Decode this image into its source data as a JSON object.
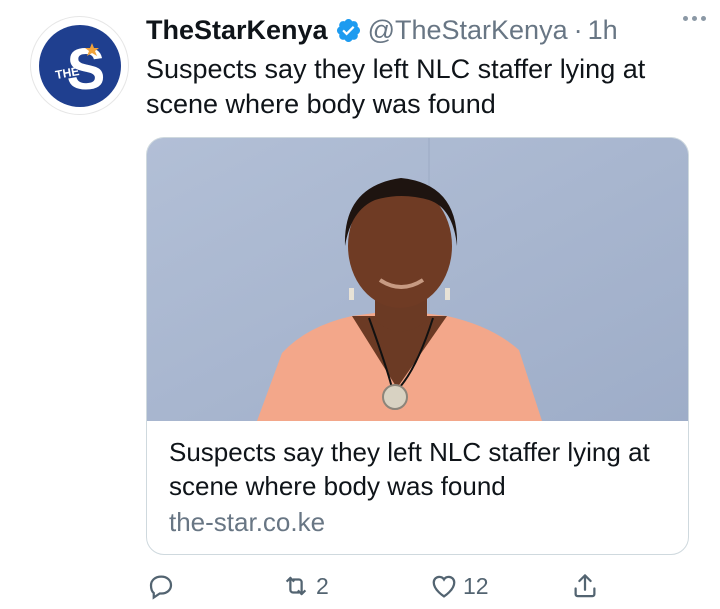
{
  "account": {
    "display_name": "TheStarKenya",
    "handle": "@TheStarKenya",
    "separator": "·",
    "time_ago": "1h",
    "avatar_letter": "S",
    "avatar_small_text": "THE"
  },
  "tweet": {
    "text": "Suspects say they left NLC staffer lying at scene where body was found"
  },
  "card": {
    "title": "Suspects say they left NLC staffer lying at scene where body was found",
    "domain": "the-star.co.ke"
  },
  "actions": {
    "reply_count": "",
    "retweet_count": "2",
    "like_count": "12"
  },
  "colors": {
    "brand_blue": "#1f3f8f",
    "verified": "#1d9bf0",
    "secondary_text": "#687684",
    "image_background": "#a9b7cf",
    "shirt": "#f3a78a"
  },
  "icons": [
    "verified-badge-icon",
    "more-options-icon",
    "reply-icon",
    "retweet-icon",
    "like-icon",
    "share-icon"
  ]
}
